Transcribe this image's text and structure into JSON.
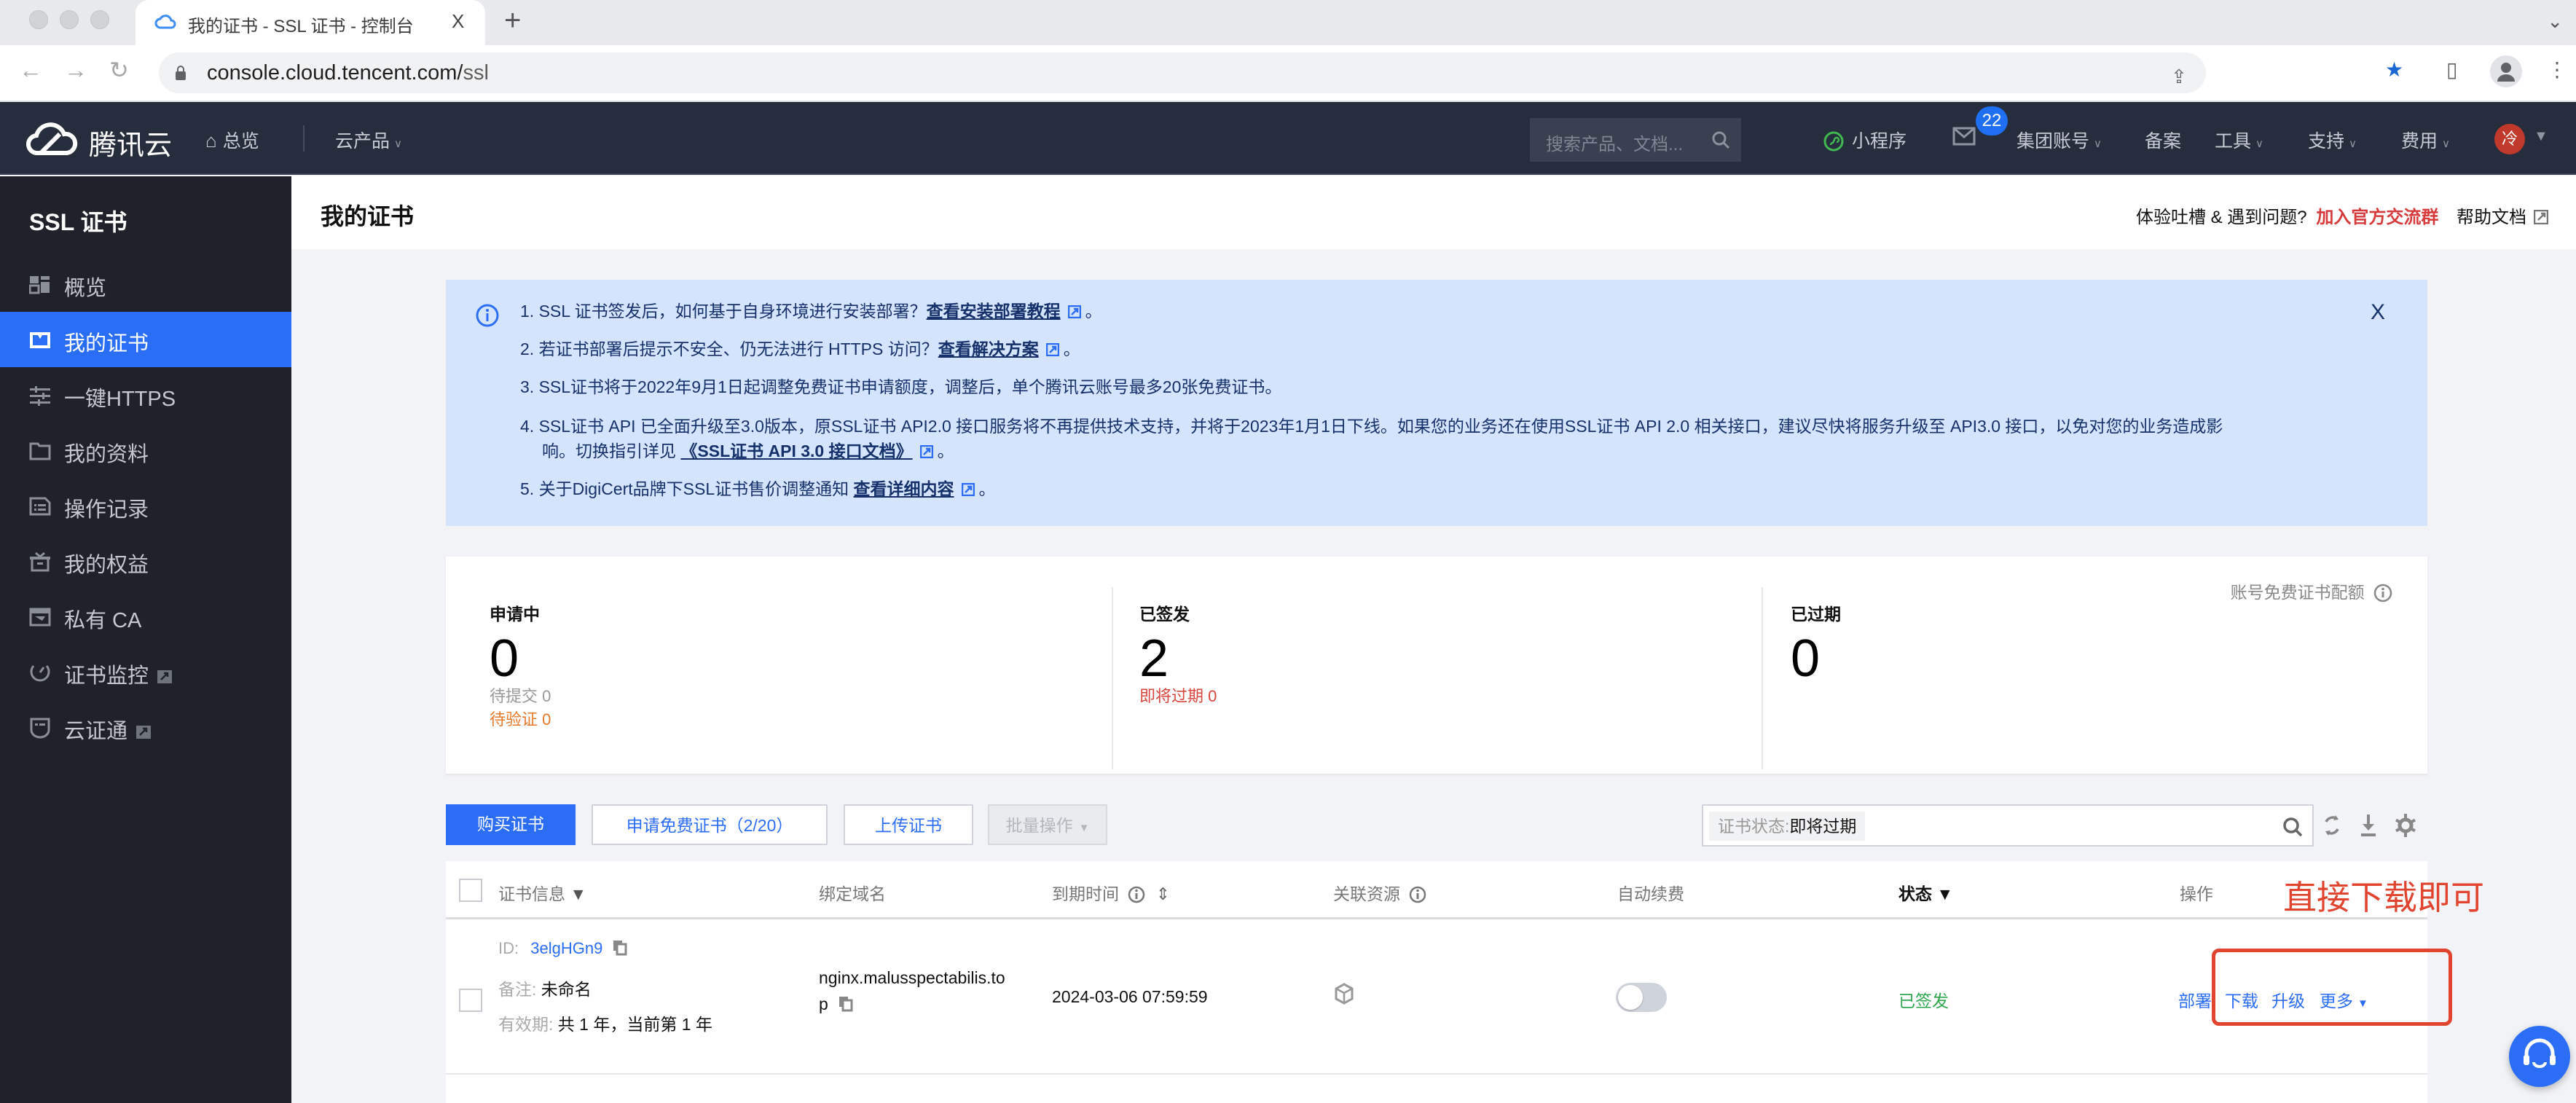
{
  "browser": {
    "tab_title": "我的证书 - SSL 证书 - 控制台",
    "tab_close": "X",
    "new_tab": "+",
    "url_host": "console.cloud.tencent.com/",
    "url_path": "ssl"
  },
  "topnav": {
    "logo_text": "腾讯云",
    "overview": "总览",
    "products": "云产品",
    "search_placeholder": "搜索产品、文档...",
    "mini_program": "小程序",
    "mail_badge": "22",
    "group_account": "集团账号",
    "beian": "备案",
    "tools": "工具",
    "support": "支持",
    "billing": "费用",
    "avatar_text": "冷"
  },
  "sidebar": {
    "title": "SSL 证书",
    "items": [
      {
        "label": "概览",
        "icon": "dashboard-icon"
      },
      {
        "label": "我的证书",
        "icon": "certificate-icon",
        "active": true
      },
      {
        "label": "一键HTTPS",
        "icon": "sliders-icon"
      },
      {
        "label": "我的资料",
        "icon": "folder-icon"
      },
      {
        "label": "操作记录",
        "icon": "log-icon"
      },
      {
        "label": "我的权益",
        "icon": "gift-icon"
      },
      {
        "label": "私有 CA",
        "icon": "private-ca-icon"
      },
      {
        "label": "证书监控",
        "icon": "monitor-icon",
        "external": true
      },
      {
        "label": "云证通",
        "icon": "shield-icon",
        "external": true
      }
    ]
  },
  "page": {
    "title": "我的证书",
    "feedback_text": "体验吐槽 & 遇到问题?",
    "join_group": "加入官方交流群",
    "help_docs": "帮助文档"
  },
  "banner": {
    "close": "X",
    "lines": [
      {
        "text": "1. SSL 证书签发后，如何基于自身环境进行安装部署？",
        "link": "查看安装部署教程",
        "end": "。"
      },
      {
        "text": "2. 若证书部署后提示不安全、仍无法进行 HTTPS 访问？",
        "link": "查看解决方案",
        "end": "。"
      },
      {
        "text": "3. SSL证书将于2022年9月1日起调整免费证书申请额度，调整后，单个腾讯云账号最多20张免费证书。"
      },
      {
        "text": "4. SSL证书 API 已全面升级至3.0版本，原SSL证书 API2.0 接口服务将不再提供技术支持，并将于2023年1月1日下线。如果您的业务还在使用SSL证书 API 2.0 相关接口，建议尽快将服务升级至 API3.0 接口，以免对您的业务造成影"
      },
      {
        "text": "响。切换指引详见 ",
        "link": "《SSL证书 API 3.0 接口文档》",
        "end": "。"
      },
      {
        "text": "5. 关于DigiCert品牌下SSL证书售价调整通知 ",
        "link": "查看详细内容",
        "end": "。"
      }
    ]
  },
  "stats": {
    "quota_label": "账号免费证书配额",
    "applying": {
      "label": "申请中",
      "value": "0",
      "pending_submit": "待提交 0",
      "pending_verify": "待验证 0"
    },
    "issued": {
      "label": "已签发",
      "value": "2",
      "expiring": "即将过期 0"
    },
    "expired": {
      "label": "已过期",
      "value": "0"
    }
  },
  "toolbar": {
    "buy": "购买证书",
    "apply_free": "申请免费证书（2/20）",
    "upload": "上传证书",
    "batch": "批量操作",
    "filter_key": "证书状态:",
    "filter_value": "即将过期"
  },
  "table": {
    "headers": {
      "cert_info": "证书信息",
      "domain": "绑定域名",
      "expire": "到期时间",
      "resources": "关联资源",
      "auto_renew": "自动续费",
      "status": "状态",
      "actions": "操作"
    },
    "rows": [
      {
        "id_label": "ID:",
        "id": "3elgHGn9",
        "remark_label": "备注:",
        "remark": "未命名",
        "validity_label": "有效期:",
        "validity": "共 1 年，当前第 1 年",
        "domain_line1": "nginx.malusspectabilis.to",
        "domain_line2": "p",
        "expire": "2024-03-06 07:59:59",
        "auto_renew": false,
        "status": "已签发",
        "actions": [
          "部署",
          "下载",
          "升级",
          "更多"
        ]
      }
    ]
  },
  "annotation": {
    "text": "直接下载即可",
    "color": "#e2452f"
  }
}
